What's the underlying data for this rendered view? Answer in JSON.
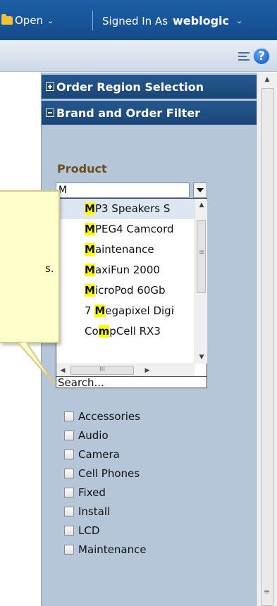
{
  "header": {
    "open_label": "Open",
    "signed_in_prefix": "Signed In As",
    "username": "weblogic"
  },
  "accordion": {
    "section1_title": "Order Region Selection",
    "section2_title": "Brand and Order Filter"
  },
  "product": {
    "label": "Product",
    "value": "M"
  },
  "dropdown": {
    "items": [
      {
        "pre": "",
        "hl": "M",
        "post": "P3 Speakers S"
      },
      {
        "pre": "",
        "hl": "M",
        "post": "PEG4 Camcord"
      },
      {
        "pre": "",
        "hl": "M",
        "post": "aintenance"
      },
      {
        "pre": "",
        "hl": "M",
        "post": "axiFun 2000"
      },
      {
        "pre": "",
        "hl": "M",
        "post": "icroPod 60Gb"
      },
      {
        "pre": "7 ",
        "hl": "M",
        "post": "egapixel Digi"
      },
      {
        "pre": "Co",
        "hl": "m",
        "post": "pCell RX3"
      }
    ],
    "search_label": "Search...",
    "hscroll_grip": "III"
  },
  "types": [
    "Accessories",
    "Audio",
    "Camera",
    "Cell Phones",
    "Fixed",
    "Install",
    "LCD",
    "Maintenance"
  ],
  "callout": {
    "text_fragment": "s."
  },
  "icons": {
    "open": "folder-icon",
    "view_menu": "list-menu-icon",
    "help": "help-icon"
  },
  "colors": {
    "header_bg": "#1a4f90",
    "panel_bg": "#b5c6d8",
    "highlight": "#ffff00",
    "label_brown": "#6d4d1b",
    "callout_bg": "#ffffcc"
  }
}
